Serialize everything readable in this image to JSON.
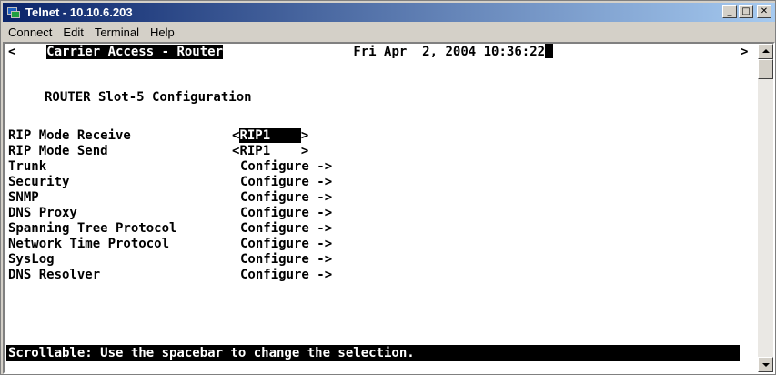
{
  "window": {
    "title": "Telnet - 10.10.6.203"
  },
  "menu": [
    "Connect",
    "Edit",
    "Terminal",
    "Help"
  ],
  "terminal": {
    "header_left_arrow": "<",
    "header_title": "Carrier Access - Router",
    "header_datetime": "Fri Apr  2, 2004 10:36:22",
    "header_right_arrow": ">",
    "subtitle": "ROUTER Slot-5 Configuration",
    "rip_receive": {
      "label": "RIP Mode Receive",
      "open": "<",
      "value": "RIP1    ",
      "close": ">"
    },
    "rip_send": {
      "label": "RIP Mode Send",
      "open": "<",
      "value": "RIP1    ",
      "close": ">"
    },
    "items": [
      {
        "label": "Trunk",
        "action": "Configure ->"
      },
      {
        "label": "Security",
        "action": "Configure ->"
      },
      {
        "label": "SNMP",
        "action": "Configure ->"
      },
      {
        "label": "DNS Proxy",
        "action": "Configure ->"
      },
      {
        "label": "Spanning Tree Protocol",
        "action": "Configure ->"
      },
      {
        "label": "Network Time Protocol",
        "action": "Configure ->"
      },
      {
        "label": "SysLog",
        "action": "Configure ->"
      },
      {
        "label": "DNS Resolver",
        "action": "Configure ->"
      }
    ],
    "status": "Scrollable: Use the spacebar to change the selection."
  },
  "colors": {
    "background": "#ffffff",
    "text": "#000000",
    "highlight": "#000000",
    "titlebar": "#0a246a"
  }
}
